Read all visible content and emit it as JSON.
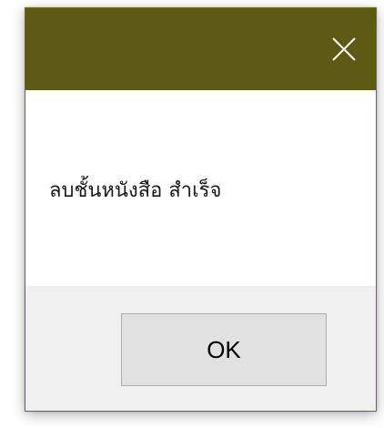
{
  "dialog": {
    "title": "",
    "message": "ลบชั้นหนังสือ สำเร็จ",
    "ok_label": "OK",
    "close_icon": "close-icon",
    "titlebar_color": "#5e5a16",
    "footer_color": "#f0f0f0"
  }
}
